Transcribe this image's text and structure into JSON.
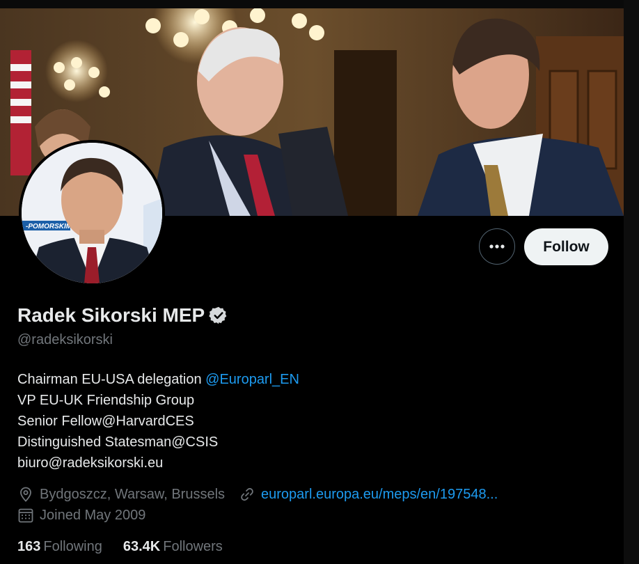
{
  "profile": {
    "name": "Radek Sikorski MEP",
    "handle": "@radeksikorski",
    "bio": {
      "line1_text": "Chairman EU-USA delegation ",
      "line1_mention": "@Europarl_EN",
      "line2": "VP EU-UK Friendship Group",
      "line3": "Senior Fellow@HarvardCES",
      "line4": "Distinguished Statesman@CSIS",
      "line5": "biuro@radeksikorski.eu"
    },
    "location": "Bydgoszcz, Warsaw, Brussels",
    "website": "europarl.europa.eu/meps/en/197548...",
    "joined": "Joined May 2009",
    "following_count": "163",
    "following_label": "Following",
    "followers_count": "63.4K",
    "followers_label": "Followers"
  },
  "actions": {
    "follow_label": "Follow",
    "more_icon": "more-horizontal-icon"
  },
  "avatar_backdrop_text": "-POMORSKIM",
  "colors": {
    "background": "#000000",
    "link": "#1d9bf0",
    "secondary_text": "#71767b",
    "primary_text": "#e7e9ea",
    "follow_button_bg": "#eff3f4"
  }
}
